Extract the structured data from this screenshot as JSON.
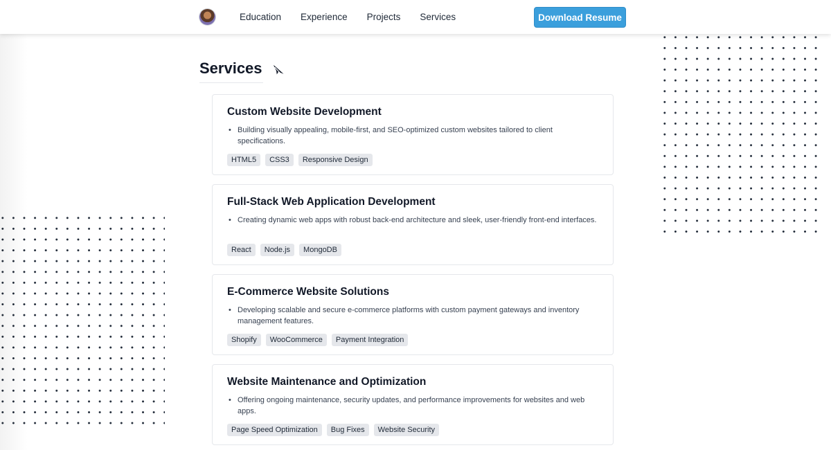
{
  "nav": {
    "links": [
      "Education",
      "Experience",
      "Projects",
      "Services"
    ],
    "download_label": "Download Resume"
  },
  "section": {
    "title": "Services",
    "icon": "paper-plane-icon"
  },
  "services": [
    {
      "title": "Custom Website Development",
      "description": "Building visually appealing, mobile-first, and SEO-optimized custom websites tailored to client specifications.",
      "tags": [
        "HTML5",
        "CSS3",
        "Responsive Design"
      ]
    },
    {
      "title": "Full-Stack Web Application Development",
      "description": "Creating dynamic web apps with robust back-end architecture and sleek, user-friendly front-end interfaces.",
      "tags": [
        "React",
        "Node.js",
        "MongoDB"
      ]
    },
    {
      "title": "E-Commerce Website Solutions",
      "description": "Developing scalable and secure e-commerce platforms with custom payment gateways and inventory management features.",
      "tags": [
        "Shopify",
        "WooCommerce",
        "Payment Integration"
      ]
    },
    {
      "title": "Website Maintenance and Optimization",
      "description": "Offering ongoing maintenance, security updates, and performance improvements for websites and web apps.",
      "tags": [
        "Page Speed Optimization",
        "Bug Fixes",
        "Website Security"
      ]
    }
  ],
  "colors": {
    "accent": "#3b9fdc",
    "tag_bg": "#e5e7eb",
    "card_border": "#e5e7eb"
  }
}
